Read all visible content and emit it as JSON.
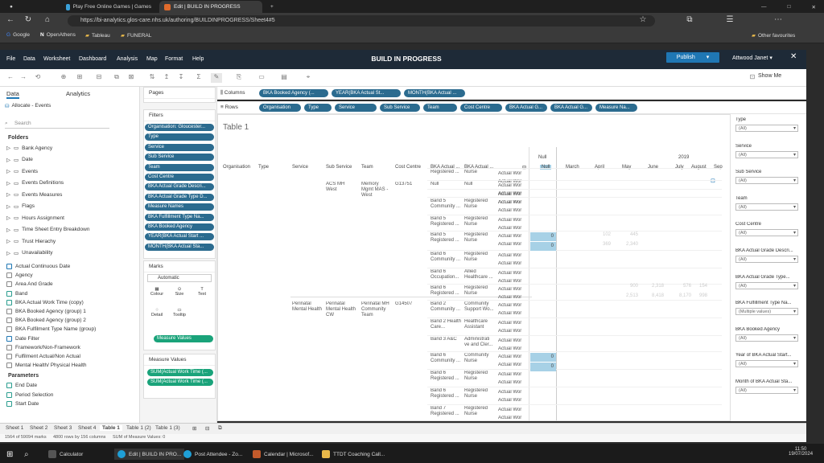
{
  "browser": {
    "tabs": [
      {
        "label": "Play Free Online Games | Games"
      },
      {
        "label": "Edit | BUILD IN PROGRESS"
      }
    ],
    "new_tab": "+",
    "url": "https://bi-analytics.glos-care.nhs.uk/authoring/BUILDINPROGRESS/Sheet4#5",
    "bookmarks": [
      "Google",
      "OpenAthens",
      "Tableau",
      "FUNERAL"
    ],
    "other_favourites": "Other favourites"
  },
  "app": {
    "menus": [
      "File",
      "Data",
      "Worksheet",
      "Dashboard",
      "Analysis",
      "Map",
      "Format",
      "Help"
    ],
    "title": "BUILD IN PROGRESS",
    "publish": "Publish",
    "user": "Attwood Janet",
    "close": "✕",
    "show_me": "Show Me"
  },
  "left": {
    "tab_data": "Data",
    "tab_analytics": "Analytics",
    "datasource": "Allocate - Events",
    "search_placeholder": "Search",
    "folders_label": "Folders",
    "folders": [
      "Bank Agency",
      "Date",
      "Events",
      "Events Definitions",
      "Events Measures",
      "Flags",
      "Hours Assignment",
      "Time Sheet Entry Breakdown",
      "Trust Hierachy",
      "Unavailability"
    ],
    "fields": [
      "Actual Continuous Date",
      "Agency",
      "Area And Grade",
      "Band",
      "BKA Actual Work Time (copy)",
      "BKA Booked Agency (group) 1",
      "BKA Booked Agency (group) 2",
      "BKA Fulfilment Type Name (group)",
      "Date Filter",
      "Framework/Non-Framework",
      "Fulfilment Actual/Non Actual",
      "Mental Health/ Physical Health"
    ],
    "params_label": "Parameters",
    "params": [
      "End Date",
      "Period Selection",
      "Start Date"
    ]
  },
  "mid": {
    "pages": "Pages",
    "filters": "Filters",
    "filter_pills": [
      "Organisation: Gloucester...",
      "Type",
      "Service",
      "Sub Service",
      "Team",
      "Cost Centre",
      "BKA Actual Grade Descri...",
      "BKA Actual Grade Type D...",
      "Measure Names",
      "BKA Fulfillment Type Na...",
      "BKA Booked Agency",
      "YEAR(BKA Actual Start ...",
      "MONTH(BKA Actual Sta..."
    ],
    "marks": "Marks",
    "marks_type": "Automatic",
    "mark_btns": [
      "Colour",
      "Size",
      "Text",
      "Detail",
      "Tooltip"
    ],
    "marks_pill": "Measure Values",
    "measure_values": "Measure Values",
    "mv_pills": [
      "SUM(Actual Work Time (...",
      "SUM(Actual Work Time (..."
    ]
  },
  "shelves": {
    "columns_label": "Columns",
    "rows_label": "Rows",
    "columns": [
      "BKA Booked Agency (...",
      "YEAR(BKA Actual St...",
      "MONTH(BKA Actual ..."
    ],
    "rows": [
      "Organisation",
      "Type",
      "Service",
      "Sub Service",
      "Team",
      "Cost Centre",
      "BKA Actual G...",
      "BKA Actual G...",
      "Measure Na..."
    ]
  },
  "view": {
    "title": "Table 1",
    "col_headers": [
      "Organisation",
      "Type",
      "Service",
      "Sub Service",
      "Team",
      "Cost Centre",
      "BKA Actual ...",
      "BKA Actual ..."
    ],
    "null_label": "Null",
    "year": "2019",
    "months": [
      "Null",
      "March",
      "April",
      "May",
      "June",
      "July",
      "August",
      "Sep"
    ],
    "group1": {
      "sub": "ACS MH West",
      "team": "Memory Mgmt MAS - West",
      "cc": "G13751"
    },
    "group2": {
      "service": "Perinatal Mental Health",
      "sub": "Perinatal Mental Health CW",
      "team": "Perinatal MH Community Team",
      "cc": "G14507"
    },
    "rows": [
      {
        "a": "Registered ...",
        "b": "Nurse",
        "m": "Actual Wor"
      },
      {
        "a": "Null",
        "b": "Null",
        "m": "Actual Wor"
      },
      {
        "a": "",
        "b": "",
        "m": "Actual Wor"
      },
      {
        "a": "Band 5 Community ...",
        "b": "Registered Nurse",
        "m": "Actual Wor"
      },
      {
        "a": "Band 5 Registered ...",
        "b": "Registered Nurse",
        "m": "Actual Wor"
      },
      {
        "a": "Band 5 Registered ...",
        "b": "Registered Nurse",
        "m": "Actual Wor",
        "v": "0"
      },
      {
        "a": "Band 6 Community ...",
        "b": "Registered Nurse",
        "m": "Actual Wor"
      },
      {
        "a": "Band 6 Occupation...",
        "b": "Allied Healthcare ...",
        "m": "Actual Wor"
      },
      {
        "a": "Band 6 Registered ...",
        "b": "Registered Nurse",
        "m": "Actual Wor"
      },
      {
        "a": "Band 2 Community ...",
        "b": "Community Support Wo...",
        "m": "Actual Wor"
      },
      {
        "a": "Band 2 Health Care...",
        "b": "Healthcare Assistant",
        "m": "Actual Wor"
      },
      {
        "a": "Band 3 A&C",
        "b": "Administrati ve and Cler...",
        "m": "Actual Wor"
      },
      {
        "a": "Band 6 Community ...",
        "b": "Community Nurse",
        "m": "Actual Wor",
        "v": "0"
      },
      {
        "a": "Band 6 Registered ...",
        "b": "Registered Nurse",
        "m": "Actual Wor"
      },
      {
        "a": "Band 6 Registered ...",
        "b": "Registered Nurse",
        "m": "Actual Wor"
      },
      {
        "a": "Band 7 Registered ...",
        "b": "Registered Nurse",
        "m": "Actual Wor"
      }
    ],
    "zeros": [
      "0",
      "0",
      "0",
      "0"
    ],
    "faint_vals": [
      {
        "r": 5,
        "c": 2,
        "v": "102"
      },
      {
        "r": 5,
        "c": 3,
        "v": "445"
      },
      {
        "r": 6,
        "c": 2,
        "v": "369"
      },
      {
        "r": 6,
        "c": 3,
        "v": "2,340"
      },
      {
        "r": 10,
        "c": 3,
        "v": "900"
      },
      {
        "r": 10,
        "c": 4,
        "v": "2,318"
      },
      {
        "r": 10,
        "c": 5,
        "v": "576"
      },
      {
        "r": 10,
        "c": 6,
        "v": "154"
      },
      {
        "r": 11,
        "c": 3,
        "v": "2,513"
      },
      {
        "r": 11,
        "c": 4,
        "v": "8,418"
      },
      {
        "r": 11,
        "c": 5,
        "v": "8,170"
      },
      {
        "r": 11,
        "c": 6,
        "v": "998"
      }
    ]
  },
  "right": {
    "filters": [
      {
        "label": "Type",
        "value": "(All)"
      },
      {
        "label": "Service",
        "value": "(All)"
      },
      {
        "label": "Sub Service",
        "value": "(All)"
      },
      {
        "label": "Team",
        "value": "(All)"
      },
      {
        "label": "Cost Centre",
        "value": "(All)"
      },
      {
        "label": "BKA Actual Grade Descri...",
        "value": "(All)"
      },
      {
        "label": "BKA Actual Grade Type...",
        "value": "(All)"
      },
      {
        "label": "BKA Fulfillment Type Na...",
        "value": "(Multiple values)"
      },
      {
        "label": "BKA Booked Agency",
        "value": "(All)"
      },
      {
        "label": "Year of BKA Actual Start...",
        "value": "(All)"
      },
      {
        "label": "Month of BKA Actual Sta...",
        "value": "(All)"
      }
    ]
  },
  "sheets": [
    "Sheet 1",
    "Sheet 2",
    "Sheet 3",
    "Sheet 4",
    "Table 1",
    "Table 1 (2)",
    "Table 1 (3)"
  ],
  "status": {
    "marks": "1564 of 59094 marks",
    "rows": "4800 rows by 156 columns",
    "sum": "SUM of Measure Values: 0"
  },
  "taskbar": {
    "items": [
      "Calculator",
      "Edit | BUILD IN PRO...",
      "Post Attendee - Zo...",
      "Calendar | Microsof...",
      "TTDT Coaching Call..."
    ],
    "time": "11:50",
    "date": "19/07/2024"
  }
}
